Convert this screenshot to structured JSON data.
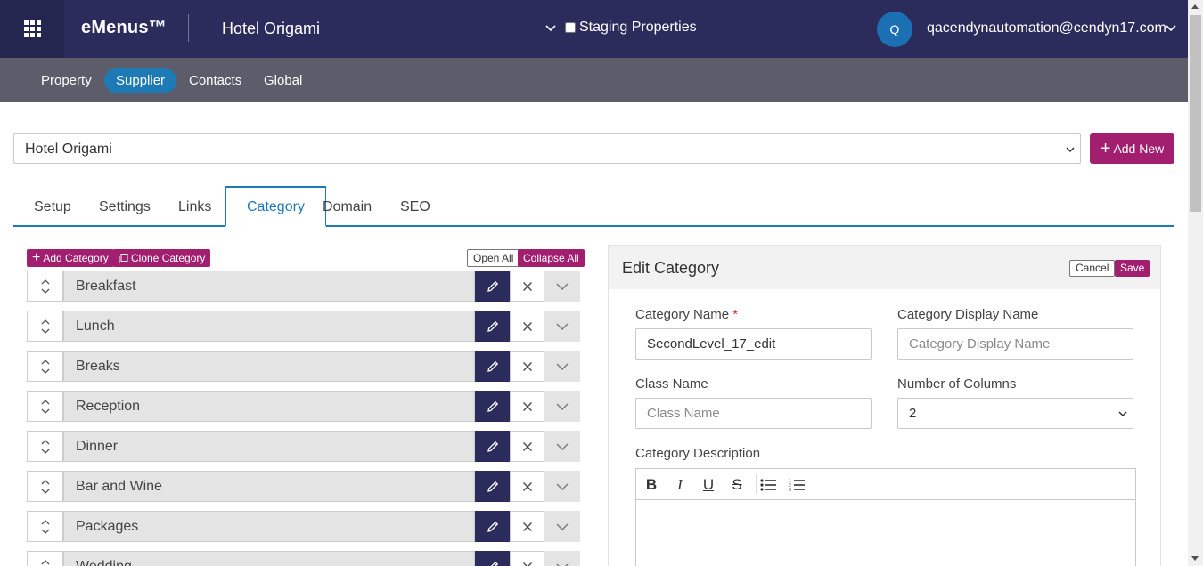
{
  "header": {
    "brand": "eMenus™",
    "hotel": "Hotel Origami",
    "staging_label": "Staging Properties",
    "avatar_initial": "Q",
    "user_email": "qacendynautomation@cendyn17.com"
  },
  "subnav": {
    "items": [
      {
        "label": "Property",
        "active": false
      },
      {
        "label": "Supplier",
        "active": true
      },
      {
        "label": "Contacts",
        "active": false
      },
      {
        "label": "Global",
        "active": false
      }
    ]
  },
  "property_select": {
    "value": "Hotel Origami"
  },
  "add_new_label": "Add New",
  "tabs": [
    {
      "label": "Setup"
    },
    {
      "label": "Settings"
    },
    {
      "label": "Links"
    },
    {
      "label": "Category",
      "active": true
    },
    {
      "label": "Domain"
    },
    {
      "label": "SEO"
    }
  ],
  "category_toolbar": {
    "add_category": "Add Category",
    "clone_category": "Clone Category",
    "open_all": "Open All",
    "collapse_all": "Collapse All"
  },
  "categories": [
    "Breakfast",
    "Lunch",
    "Breaks",
    "Reception",
    "Dinner",
    "Bar and Wine",
    "Packages",
    "Wedding"
  ],
  "edit_panel": {
    "title": "Edit Category",
    "cancel": "Cancel",
    "save": "Save",
    "category_name_label": "Category Name",
    "required_mark": "*",
    "category_name_value": "SecondLevel_17_edit",
    "display_name_label": "Category Display Name",
    "display_name_placeholder": "Category Display Name",
    "class_name_label": "Class Name",
    "class_name_placeholder": "Class Name",
    "columns_label": "Number of Columns",
    "columns_value": "2",
    "description_label": "Category Description",
    "toolbar": {
      "bold": "B",
      "italic": "I",
      "underline": "U",
      "strike": "S"
    }
  },
  "colors": {
    "topbar": "#2b2c5b",
    "subnav": "#5d5c6b",
    "accent_blue": "#1d7ab4",
    "magenta": "#a11f6e"
  }
}
